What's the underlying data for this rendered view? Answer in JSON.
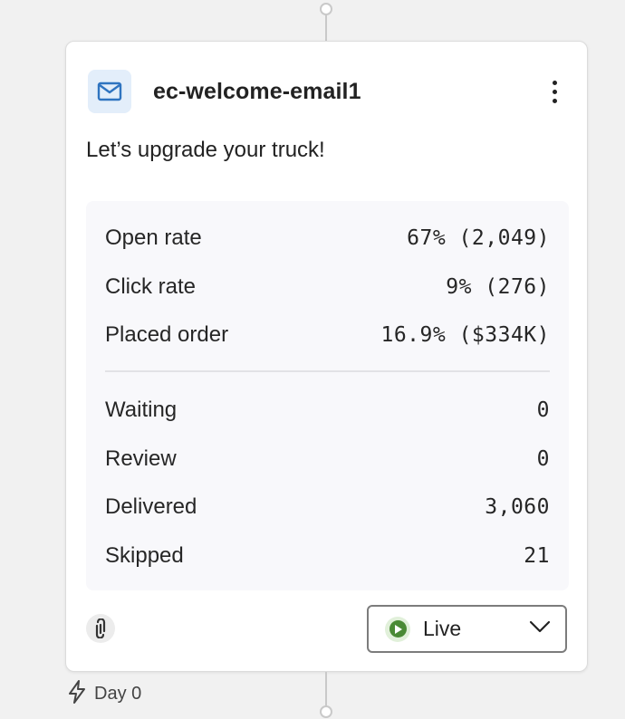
{
  "card": {
    "title": "ec-welcome-email1",
    "subject": "Let’s upgrade your truck!",
    "icon": "mail-icon",
    "accent_color": "#2f74c0"
  },
  "metrics": [
    {
      "label": "Open rate",
      "value": "67% (2,049)"
    },
    {
      "label": "Click rate",
      "value": "9% (276)"
    },
    {
      "label": "Placed order",
      "value": "16.9% ($334K)"
    }
  ],
  "counts": [
    {
      "label": "Waiting",
      "value": "0"
    },
    {
      "label": "Review",
      "value": "0"
    },
    {
      "label": "Delivered",
      "value": "3,060"
    },
    {
      "label": "Skipped",
      "value": "21"
    }
  ],
  "status": {
    "selected": "Live",
    "color": "#4a8a35"
  },
  "trigger": {
    "label": "Day 0",
    "icon": "lightning-icon"
  }
}
